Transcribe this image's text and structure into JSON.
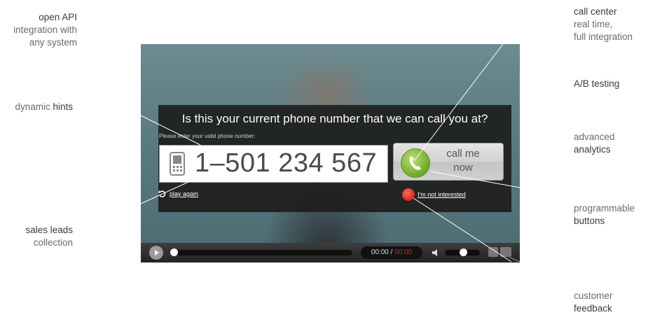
{
  "left_labels": [
    {
      "line1": "open API",
      "line2": "integration with",
      "line3": "any system"
    },
    {
      "plain": "dynamic ",
      "bold": "hints"
    },
    {
      "line1": "sales leads",
      "line2": "collection"
    }
  ],
  "right_labels": [
    {
      "line1": "call center",
      "line2": "real time,",
      "line3": "full integration"
    },
    {
      "line1": "A/B testing"
    },
    {
      "line1": "advanced",
      "line2": "analytics"
    },
    {
      "line1": "programmable",
      "line2": "buttons"
    },
    {
      "line1": "customer",
      "line2": "feedback"
    }
  ],
  "player": {
    "question": "Is this your current phone number that we can call you at?",
    "hint": "Please enter your valid phone number:",
    "phone_number": "1–501 234 567",
    "call_button": "call me\nnow",
    "play_again": "play again",
    "not_interested": "I'm not interested",
    "time_current": "00:00",
    "time_separator": " / ",
    "time_duration": "00:00",
    "progress_fraction": 0,
    "volume_fraction": 0.55
  },
  "colors": {
    "accent_green": "#6fa92a",
    "hangup_red": "#d0211b",
    "duration_red": "#d82b20"
  }
}
